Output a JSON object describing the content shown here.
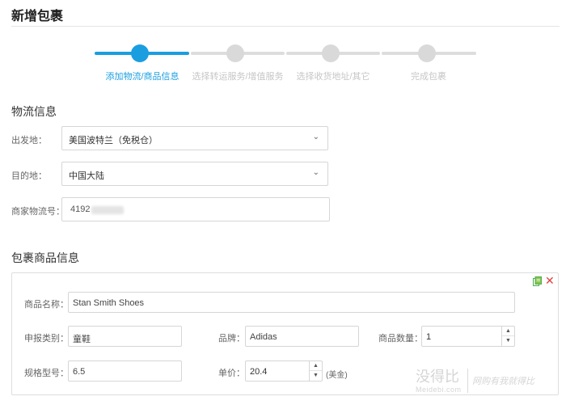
{
  "page_title": "新增包裹",
  "stepper": {
    "steps": [
      {
        "label": "添加物流/商品信息",
        "state": "active"
      },
      {
        "label": "选择转运服务/增值服务",
        "state": "pending"
      },
      {
        "label": "选择收货地址/其它",
        "state": "pending"
      },
      {
        "label": "完成包裹",
        "state": "pending"
      }
    ],
    "active_color": "#1a9ee0",
    "inactive_color": "#d9d9d9"
  },
  "logistics": {
    "section_title": "物流信息",
    "origin": {
      "label": "出发地：",
      "value": "美国波特兰（免税仓）",
      "icon": "chevron-down-icon"
    },
    "destination": {
      "label": "目的地：",
      "value": "中国大陆",
      "icon": "chevron-down-icon"
    },
    "tracking": {
      "label": "商家物流号：",
      "value": "4192"
    }
  },
  "goods": {
    "section_title": "包裹商品信息",
    "icons": {
      "copy": "copy-icon",
      "remove": "close-icon"
    },
    "product_name": {
      "label": "商品名称：",
      "value": "Stan Smith Shoes"
    },
    "category": {
      "label": "申报类别：",
      "value": "童鞋"
    },
    "brand": {
      "label": "品牌：",
      "value": "Adidas"
    },
    "quantity": {
      "label": "商品数量：",
      "value": "1"
    },
    "spec": {
      "label": "规格型号：",
      "value": "6.5"
    },
    "unit_price": {
      "label": "单价：",
      "value": "20.4",
      "unit": "(美金)"
    }
  },
  "watermark": {
    "title": "没得比",
    "domain": "Meidebi.com",
    "slogan": "网购有我就得比"
  }
}
